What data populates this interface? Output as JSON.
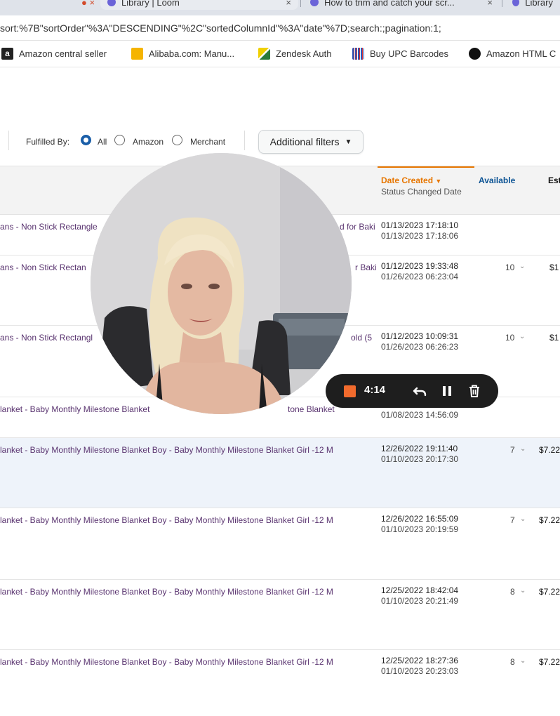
{
  "browser": {
    "tabs": [
      {
        "label": "Library | Loom",
        "close": "×"
      },
      {
        "label": "How to trim and catch your scr...",
        "close": "×"
      },
      {
        "label": "Library",
        "close": ""
      }
    ],
    "url": "sort:%7B\"sortOrder\"%3A\"DESCENDING\"%2C\"sortedColumnId\"%3A\"date\"%7D;search:;pagination:1;",
    "bookmarks": [
      {
        "label": "Amazon central seller",
        "icon": "amazon-icon"
      },
      {
        "label": "Alibaba.com: Manu...",
        "icon": "alibaba-icon"
      },
      {
        "label": "Zendesk Auth",
        "icon": "zendesk-icon"
      },
      {
        "label": "Buy UPC Barcodes",
        "icon": "barcode-icon"
      },
      {
        "label": "Amazon HTML C",
        "icon": "amazon-html-icon"
      }
    ]
  },
  "filters": {
    "fulfilled_by_label": "Fulfilled By:",
    "options": [
      "All",
      "Amazon",
      "Merchant"
    ],
    "selected": "All",
    "additional_filters": "Additional filters"
  },
  "table": {
    "headers": {
      "date_created": "Date Created",
      "status_changed": "Status Changed Date",
      "available": "Available",
      "est": "Est"
    },
    "rows": [
      {
        "product": "ans - Non Stick Rectangle",
        "product_tail": "d for Baki",
        "created": "01/13/2023 17:18:10",
        "changed": "01/13/2023 17:18:06",
        "available": "",
        "price": ""
      },
      {
        "product": "ans - Non Stick Rectan",
        "product_tail": "r Baki",
        "created": "01/12/2023 19:33:48",
        "changed": "01/26/2023 06:23:04",
        "available": "10",
        "price": "$1"
      },
      {
        "product": "ans - Non Stick Rectangl",
        "product_tail": "old (5",
        "created": "01/12/2023 10:09:31",
        "changed": "01/26/2023 06:26:23",
        "available": "10",
        "price": "$1"
      },
      {
        "product": "lanket - Baby Monthly Milestone Blanket",
        "product_tail": "tone Blanket",
        "created": "",
        "changed": "01/08/2023 14:56:09",
        "available": "",
        "price": ""
      },
      {
        "product": "lanket - Baby Monthly Milestone Blanket Boy - Baby Monthly Milestone Blanket Girl -12 M",
        "product_tail": "",
        "created": "12/26/2022 19:11:40",
        "changed": "01/10/2023 20:17:30",
        "available": "7",
        "price": "$7.22"
      },
      {
        "product": "lanket - Baby Monthly Milestone Blanket Boy - Baby Monthly Milestone Blanket Girl -12 M",
        "product_tail": "",
        "created": "12/26/2022 16:55:09",
        "changed": "01/10/2023 20:19:59",
        "available": "7",
        "price": "$7.22"
      },
      {
        "product": "lanket - Baby Monthly Milestone Blanket Boy - Baby Monthly Milestone Blanket Girl -12 M",
        "product_tail": "",
        "created": "12/25/2022 18:42:04",
        "changed": "01/10/2023 20:21:49",
        "available": "8",
        "price": "$7.22"
      },
      {
        "product": "lanket - Baby Monthly Milestone Blanket Boy - Baby Monthly Milestone Blanket Girl -12 M",
        "product_tail": "",
        "created": "12/25/2022 18:27:36",
        "changed": "01/10/2023 20:23:03",
        "available": "8",
        "price": "$7.22"
      }
    ]
  },
  "recorder": {
    "time": "4:14",
    "stop_color": "#f26b2d"
  },
  "colors": {
    "accent_orange": "#e77600",
    "link_blue": "#0b5394",
    "radio_blue": "#1a5ea8",
    "highlight_row": "#eef3fa"
  }
}
